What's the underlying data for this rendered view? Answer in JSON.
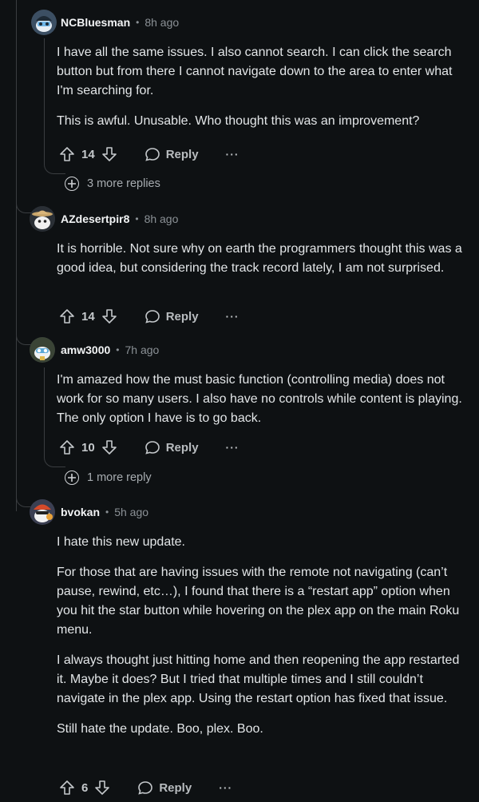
{
  "comments": [
    {
      "username": "NCBluesman",
      "time": "8h ago",
      "paragraphs": [
        "I have all the same issues. I also cannot search. I can click the search button but from there I cannot navigate down to the area to enter what I'm searching for.",
        "This is awful. Unusable. Who thought this was an improvement?"
      ],
      "score": "14",
      "reply_label": "Reply",
      "more_label": "···",
      "more_replies": "3 more replies"
    },
    {
      "username": "AZdesertpir8",
      "time": "8h ago",
      "paragraphs": [
        "It is horrible. Not sure why on earth the programmers thought this was a good idea, but considering the track record lately, I am not surprised."
      ],
      "score": "14",
      "reply_label": "Reply",
      "more_label": "···"
    },
    {
      "username": "amw3000",
      "time": "7h ago",
      "paragraphs": [
        "I'm amazed how the must basic function (controlling media) does not work for so many users. I also have no controls while content is playing. The only option I have is to go back."
      ],
      "score": "10",
      "reply_label": "Reply",
      "more_label": "···",
      "more_replies": "1 more reply"
    },
    {
      "username": "bvokan",
      "time": "5h ago",
      "paragraphs": [
        "I hate this new update.",
        "For those that are having issues with the remote not navigating (can’t pause, rewind, etc…), I found that there is a “restart app” option when you hit the star button while hovering on the plex app on the main Roku menu.",
        "I always thought just hitting home and then reopening the app restarted it. Maybe it does? But I tried that multiple times and I still couldn’t navigate in the plex app. Using the restart option has fixed that issue.",
        "Still hate the update. Boo, plex. Boo."
      ],
      "score": "6",
      "reply_label": "Reply",
      "more_label": "···"
    }
  ],
  "colors": {
    "background": "#0e1113",
    "text": "#e3e6e8",
    "muted": "#8b9196",
    "thread_line": "#3a3d40"
  }
}
